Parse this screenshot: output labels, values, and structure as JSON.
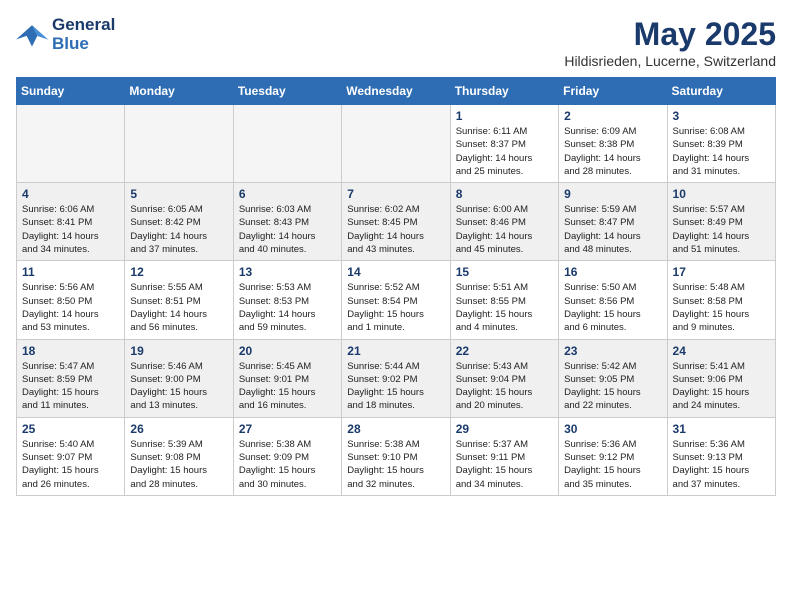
{
  "logo": {
    "line1": "General",
    "line2": "Blue"
  },
  "title": {
    "month_year": "May 2025",
    "location": "Hildisrieden, Lucerne, Switzerland"
  },
  "headers": [
    "Sunday",
    "Monday",
    "Tuesday",
    "Wednesday",
    "Thursday",
    "Friday",
    "Saturday"
  ],
  "weeks": [
    [
      {
        "day": "",
        "info": ""
      },
      {
        "day": "",
        "info": ""
      },
      {
        "day": "",
        "info": ""
      },
      {
        "day": "",
        "info": ""
      },
      {
        "day": "1",
        "info": "Sunrise: 6:11 AM\nSunset: 8:37 PM\nDaylight: 14 hours\nand 25 minutes."
      },
      {
        "day": "2",
        "info": "Sunrise: 6:09 AM\nSunset: 8:38 PM\nDaylight: 14 hours\nand 28 minutes."
      },
      {
        "day": "3",
        "info": "Sunrise: 6:08 AM\nSunset: 8:39 PM\nDaylight: 14 hours\nand 31 minutes."
      }
    ],
    [
      {
        "day": "4",
        "info": "Sunrise: 6:06 AM\nSunset: 8:41 PM\nDaylight: 14 hours\nand 34 minutes."
      },
      {
        "day": "5",
        "info": "Sunrise: 6:05 AM\nSunset: 8:42 PM\nDaylight: 14 hours\nand 37 minutes."
      },
      {
        "day": "6",
        "info": "Sunrise: 6:03 AM\nSunset: 8:43 PM\nDaylight: 14 hours\nand 40 minutes."
      },
      {
        "day": "7",
        "info": "Sunrise: 6:02 AM\nSunset: 8:45 PM\nDaylight: 14 hours\nand 43 minutes."
      },
      {
        "day": "8",
        "info": "Sunrise: 6:00 AM\nSunset: 8:46 PM\nDaylight: 14 hours\nand 45 minutes."
      },
      {
        "day": "9",
        "info": "Sunrise: 5:59 AM\nSunset: 8:47 PM\nDaylight: 14 hours\nand 48 minutes."
      },
      {
        "day": "10",
        "info": "Sunrise: 5:57 AM\nSunset: 8:49 PM\nDaylight: 14 hours\nand 51 minutes."
      }
    ],
    [
      {
        "day": "11",
        "info": "Sunrise: 5:56 AM\nSunset: 8:50 PM\nDaylight: 14 hours\nand 53 minutes."
      },
      {
        "day": "12",
        "info": "Sunrise: 5:55 AM\nSunset: 8:51 PM\nDaylight: 14 hours\nand 56 minutes."
      },
      {
        "day": "13",
        "info": "Sunrise: 5:53 AM\nSunset: 8:53 PM\nDaylight: 14 hours\nand 59 minutes."
      },
      {
        "day": "14",
        "info": "Sunrise: 5:52 AM\nSunset: 8:54 PM\nDaylight: 15 hours\nand 1 minute."
      },
      {
        "day": "15",
        "info": "Sunrise: 5:51 AM\nSunset: 8:55 PM\nDaylight: 15 hours\nand 4 minutes."
      },
      {
        "day": "16",
        "info": "Sunrise: 5:50 AM\nSunset: 8:56 PM\nDaylight: 15 hours\nand 6 minutes."
      },
      {
        "day": "17",
        "info": "Sunrise: 5:48 AM\nSunset: 8:58 PM\nDaylight: 15 hours\nand 9 minutes."
      }
    ],
    [
      {
        "day": "18",
        "info": "Sunrise: 5:47 AM\nSunset: 8:59 PM\nDaylight: 15 hours\nand 11 minutes."
      },
      {
        "day": "19",
        "info": "Sunrise: 5:46 AM\nSunset: 9:00 PM\nDaylight: 15 hours\nand 13 minutes."
      },
      {
        "day": "20",
        "info": "Sunrise: 5:45 AM\nSunset: 9:01 PM\nDaylight: 15 hours\nand 16 minutes."
      },
      {
        "day": "21",
        "info": "Sunrise: 5:44 AM\nSunset: 9:02 PM\nDaylight: 15 hours\nand 18 minutes."
      },
      {
        "day": "22",
        "info": "Sunrise: 5:43 AM\nSunset: 9:04 PM\nDaylight: 15 hours\nand 20 minutes."
      },
      {
        "day": "23",
        "info": "Sunrise: 5:42 AM\nSunset: 9:05 PM\nDaylight: 15 hours\nand 22 minutes."
      },
      {
        "day": "24",
        "info": "Sunrise: 5:41 AM\nSunset: 9:06 PM\nDaylight: 15 hours\nand 24 minutes."
      }
    ],
    [
      {
        "day": "25",
        "info": "Sunrise: 5:40 AM\nSunset: 9:07 PM\nDaylight: 15 hours\nand 26 minutes."
      },
      {
        "day": "26",
        "info": "Sunrise: 5:39 AM\nSunset: 9:08 PM\nDaylight: 15 hours\nand 28 minutes."
      },
      {
        "day": "27",
        "info": "Sunrise: 5:38 AM\nSunset: 9:09 PM\nDaylight: 15 hours\nand 30 minutes."
      },
      {
        "day": "28",
        "info": "Sunrise: 5:38 AM\nSunset: 9:10 PM\nDaylight: 15 hours\nand 32 minutes."
      },
      {
        "day": "29",
        "info": "Sunrise: 5:37 AM\nSunset: 9:11 PM\nDaylight: 15 hours\nand 34 minutes."
      },
      {
        "day": "30",
        "info": "Sunrise: 5:36 AM\nSunset: 9:12 PM\nDaylight: 15 hours\nand 35 minutes."
      },
      {
        "day": "31",
        "info": "Sunrise: 5:36 AM\nSunset: 9:13 PM\nDaylight: 15 hours\nand 37 minutes."
      }
    ]
  ]
}
